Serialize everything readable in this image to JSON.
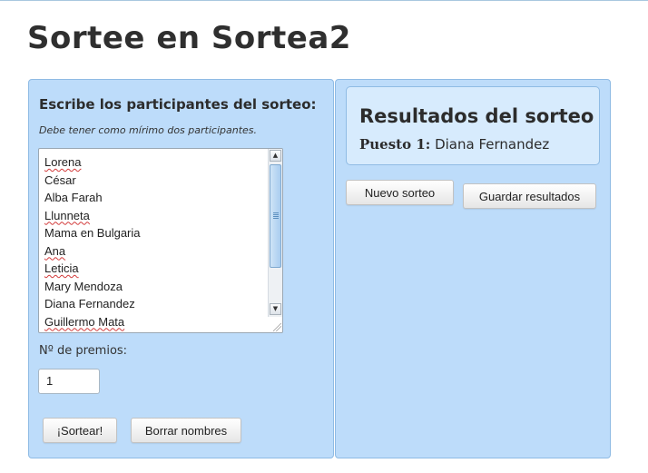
{
  "page": {
    "title": "Sortee en Sortea2"
  },
  "left_panel": {
    "heading": "Escribe los participantes del sorteo:",
    "hint": "Debe tener como mírimo dos participantes.",
    "participants": [
      "Lorena",
      "César",
      "Alba Farah",
      "Llunneta",
      "Mama en Bulgaria",
      "Ana",
      "Leticia",
      "Mary Mendoza",
      "Diana Fernandez",
      "Guillermo Mata"
    ],
    "premios_label": "Nº de premios:",
    "premios_value": "1",
    "sortear_button": "¡Sortear!",
    "borrar_button": "Borrar nombres"
  },
  "right_panel": {
    "results_title": "Resultados del sorteo",
    "result_label": "Puesto 1:",
    "result_value": "Diana Fernandez",
    "nuevo_button": "Nuevo sorteo",
    "guardar_button": "Guardar resultados"
  },
  "colors": {
    "panel_bg": "#bddcfa",
    "panel_border": "#8fbbe4",
    "result_bg": "#d7ebfd"
  },
  "icons": {
    "scroll_up": "arrow-up-icon",
    "scroll_down": "arrow-down-icon",
    "resize": "resize-grip-icon"
  }
}
